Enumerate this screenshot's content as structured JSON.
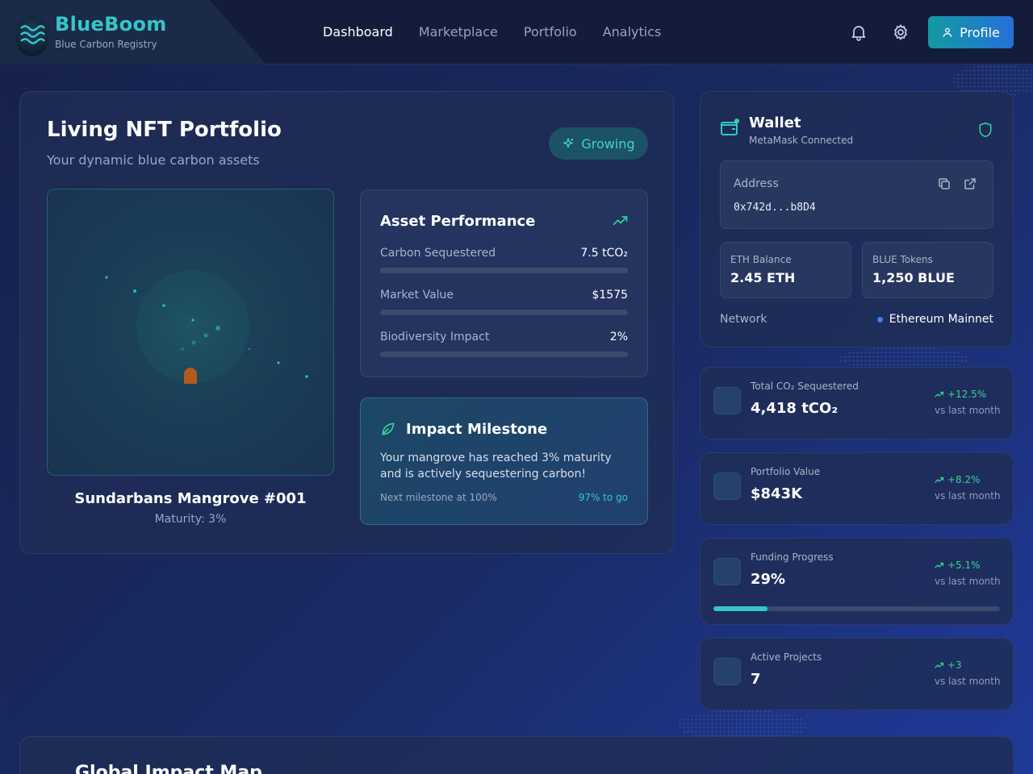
{
  "header": {
    "brand_name": "BlueBoom",
    "brand_subtitle": "Blue Carbon Registry",
    "nav": [
      "Dashboard",
      "Marketplace",
      "Portfolio",
      "Analytics"
    ],
    "active_nav": "Dashboard",
    "profile_label": "Profile"
  },
  "portfolio": {
    "title": "Living NFT Portfolio",
    "subtitle": "Your dynamic blue carbon assets",
    "status_badge": "Growing",
    "nft_name": "Sundarbans Mangrove #001",
    "nft_maturity": "Maturity: 3%"
  },
  "performance": {
    "title": "Asset Performance",
    "metrics": [
      {
        "label": "Carbon Sequestered",
        "value": "7.5 tCO₂",
        "progress": 0.0
      },
      {
        "label": "Market Value",
        "value": "$1575",
        "progress": 0.0
      },
      {
        "label": "Biodiversity Impact",
        "value": "2%",
        "progress": 0.0
      }
    ]
  },
  "milestone": {
    "title": "Impact Milestone",
    "text": "Your mangrove has reached 3% maturity and is actively sequestering carbon!",
    "next": "Next milestone at 100%",
    "togo": "97% to go"
  },
  "wallet": {
    "title": "Wallet",
    "subtitle": "MetaMask Connected",
    "address_label": "Address",
    "address": "0x742d...b8D4",
    "eth_label": "ETH Balance",
    "eth_value": "2.45 ETH",
    "blue_label": "BLUE Tokens",
    "blue_value": "1,250 BLUE",
    "network_label": "Network",
    "network_value": "Ethereum Mainnet"
  },
  "stats": [
    {
      "label": "Total CO₂ Sequestered",
      "value": "4,418 tCO₂",
      "change": "+12.5%",
      "compare": "vs last month"
    },
    {
      "label": "Portfolio Value",
      "value": "$843K",
      "change": "+8.2%",
      "compare": "vs last month"
    },
    {
      "label": "Funding Progress",
      "value": "29%",
      "change": "+5.1%",
      "compare": "vs last month",
      "progress": 0.19
    },
    {
      "label": "Active Projects",
      "value": "7",
      "change": "+3",
      "compare": "vs last month"
    }
  ],
  "map": {
    "title": "Global Impact Map"
  },
  "colors": {
    "accent": "#35c6c8",
    "positive": "#34d399",
    "background": "#1a2a63"
  },
  "icons": [
    "logo-waves-icon",
    "bell-icon",
    "gear-icon",
    "user-icon",
    "sparkles-icon",
    "trend-up-icon",
    "leaf-icon",
    "wallet-icon",
    "shield-icon",
    "copy-icon",
    "external-link-icon"
  ]
}
